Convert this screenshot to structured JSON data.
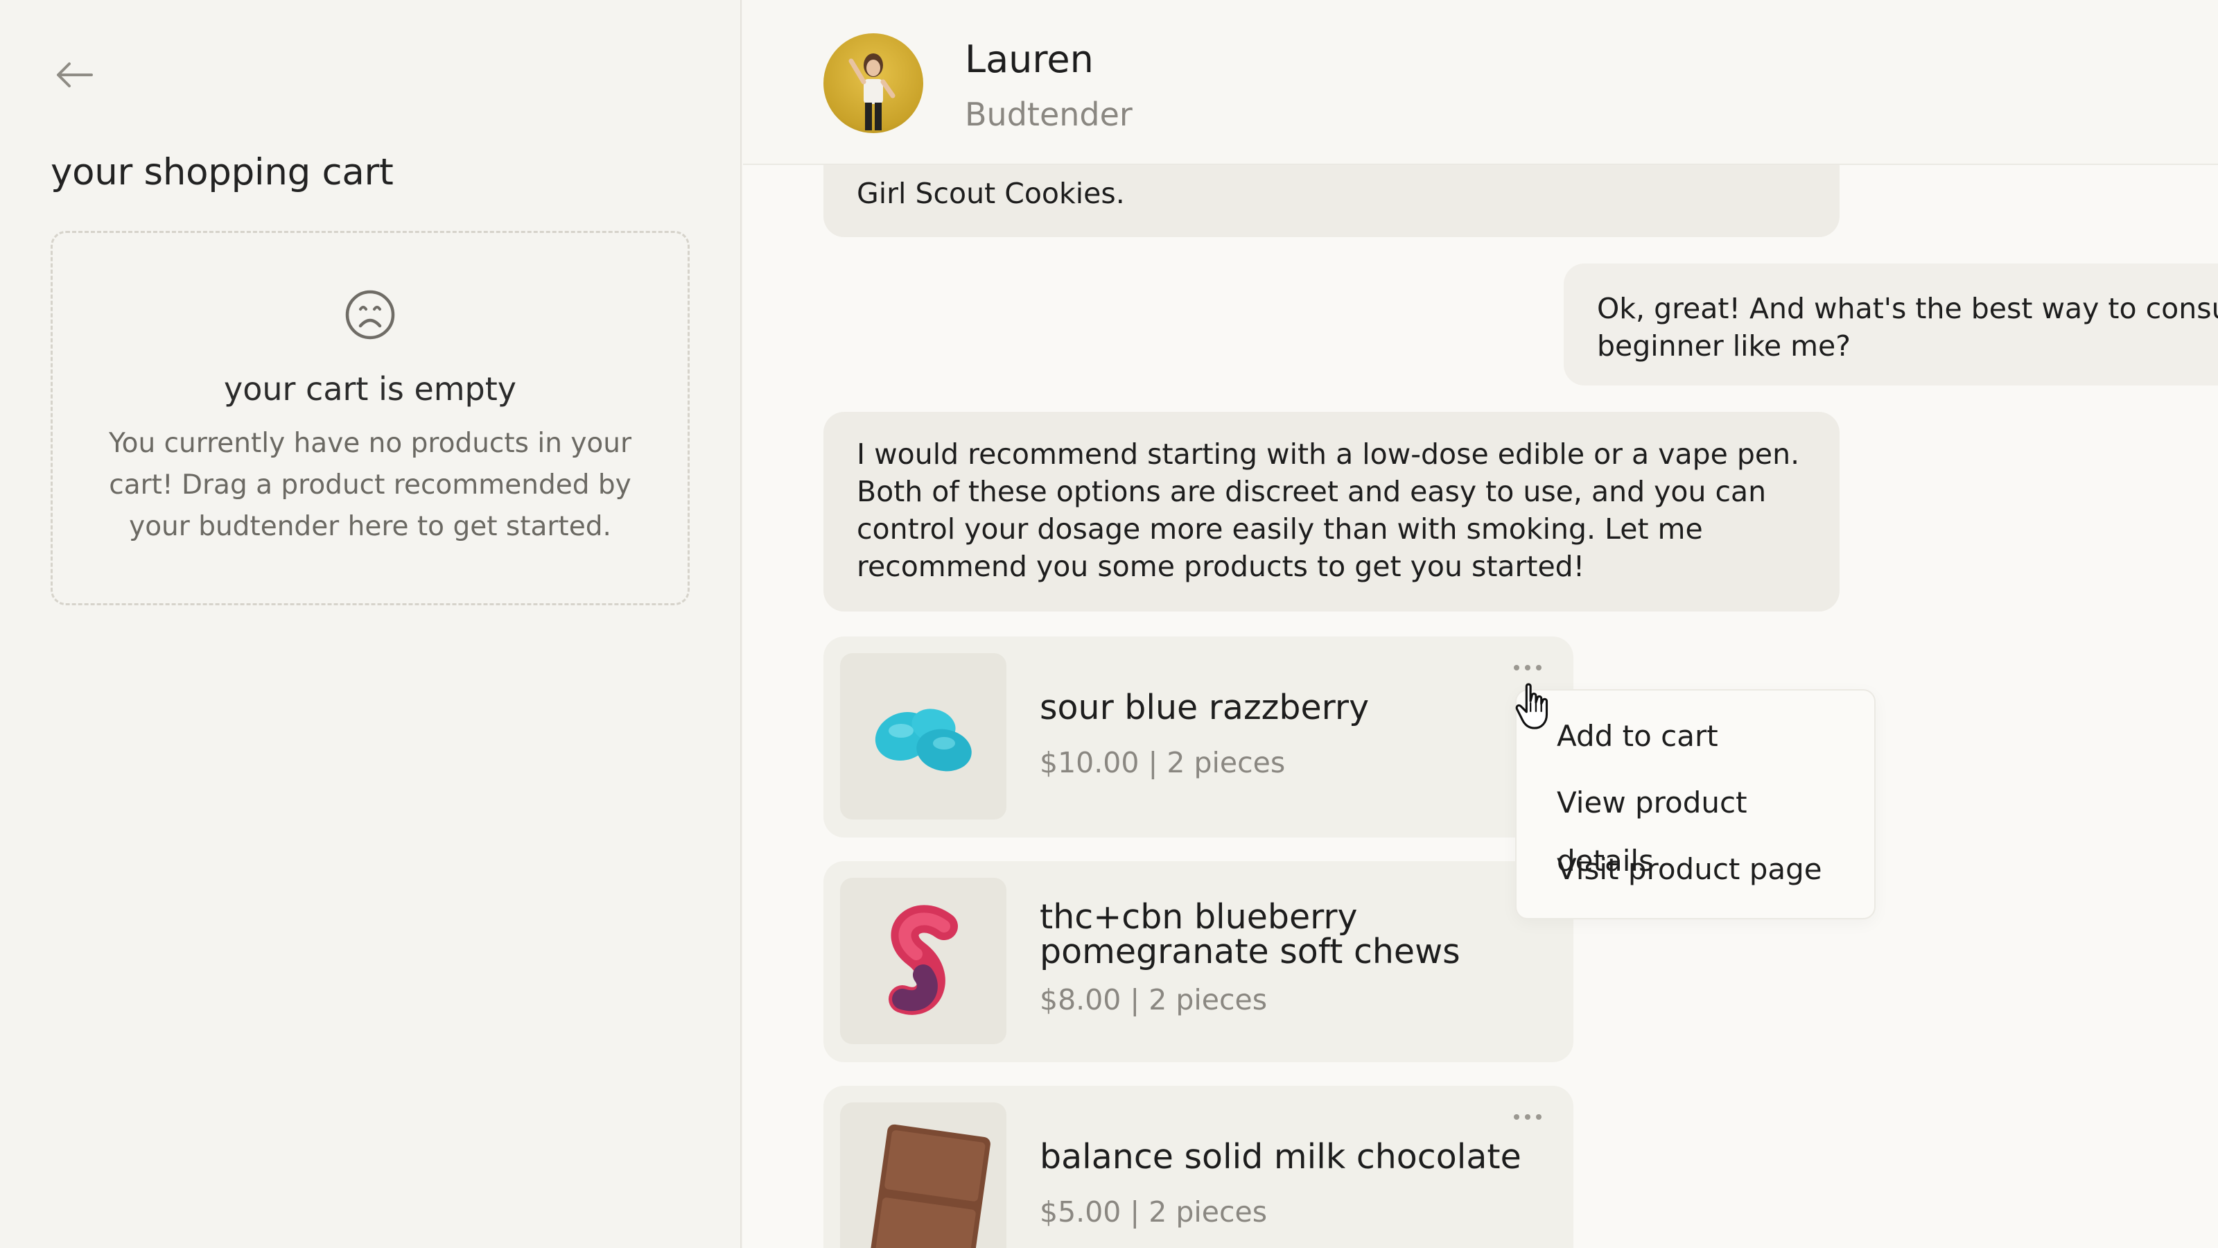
{
  "cart": {
    "title": "your shopping cart",
    "empty_title": "your cart is empty",
    "empty_description": "You currently have no products in your cart! Drag a product recommended by your budtender here to get started."
  },
  "header": {
    "agent_name": "Lauren",
    "agent_role": "Budtender"
  },
  "messages": [
    {
      "from": "bot",
      "text": "Girl Scout Cookies."
    },
    {
      "from": "user",
      "text": "Ok, great! And what's the best way to consume\nbeginner like me?"
    },
    {
      "from": "bot",
      "text": "I would recommend starting with a low-dose edible or a vape pen. Both of these options are discreet and easy to use, and you can control your dosage more easily than with smoking. Let me recommend you some products to get you started!"
    }
  ],
  "products": [
    {
      "name": "sour blue razzberry",
      "meta": "$10.00 | 2 pieces"
    },
    {
      "name": "thc+cbn blueberry pomegranate soft chews",
      "meta": "$8.00 | 2 pieces"
    },
    {
      "name": "balance solid milk chocolate",
      "meta": "$5.00 | 2 pieces"
    }
  ],
  "context_menu": {
    "items": [
      "Add to cart",
      "View product details",
      "Visit product page"
    ]
  },
  "icons": {
    "back": "arrow-left-icon",
    "empty_cart": "sad-face-icon",
    "more": "more-horizontal-icon",
    "cursor": "hand-pointer-icon"
  }
}
